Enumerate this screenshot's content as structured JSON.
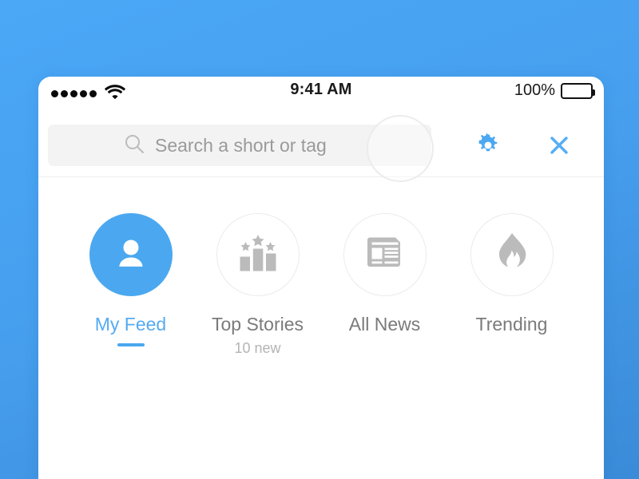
{
  "theme": {
    "background_gradient_from": "#4aa8f7",
    "background_gradient_to": "#3a8bd8",
    "accent_blue": "#4ba8f0",
    "card_background": "#ffffff",
    "search_field_background": "#f3f3f3",
    "inactive_gray": "#7a7a7a",
    "subtitle_gray": "#b4b4b4"
  },
  "status_bar": {
    "signal_dots": 5,
    "wifi_icon": "wifi-icon",
    "time": "9:41 AM",
    "battery_percent": "100%",
    "battery_icon": "battery-full-icon"
  },
  "search": {
    "icon": "search-icon",
    "placeholder": "Search a short or tag",
    "value": "",
    "touch_indicator": "touch-ring-indicator",
    "gear_icon": "gear-icon",
    "close_icon": "close-icon"
  },
  "categories": [
    {
      "label": "My Feed",
      "icon": "person-icon",
      "subtitle": "",
      "active": true
    },
    {
      "label": "Top Stories",
      "icon": "bar-chart-stars-icon",
      "subtitle": "10 new",
      "active": false
    },
    {
      "label": "All News",
      "icon": "newspaper-icon",
      "subtitle": "",
      "active": false
    },
    {
      "label": "Trending",
      "icon": "flame-icon",
      "subtitle": "",
      "active": false
    }
  ]
}
